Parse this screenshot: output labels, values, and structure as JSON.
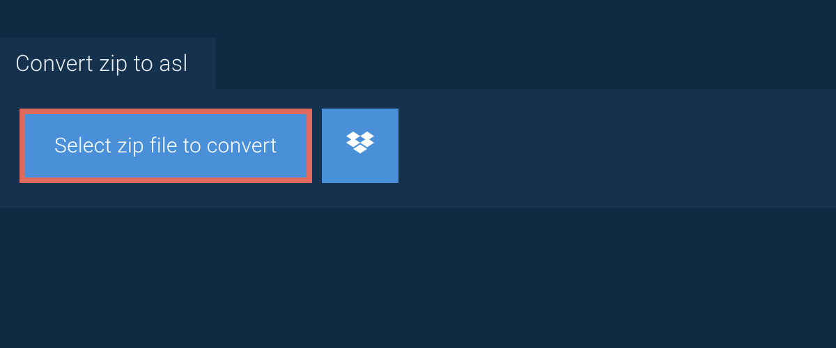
{
  "tab": {
    "title": "Convert zip to asl"
  },
  "buttons": {
    "select_file_label": "Select zip file to convert"
  }
}
